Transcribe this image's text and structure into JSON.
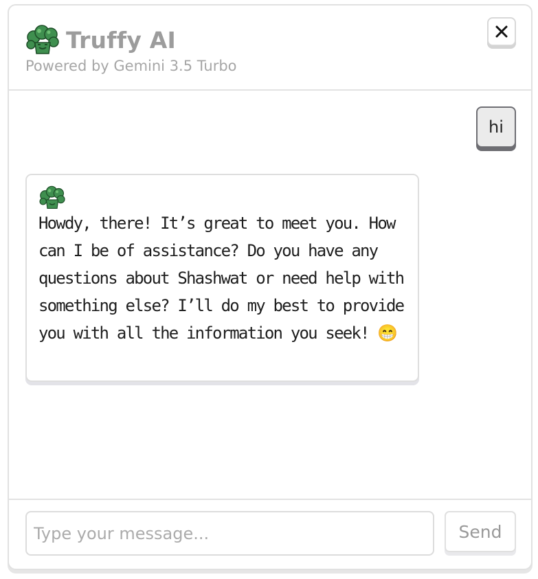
{
  "header": {
    "title": "Truffy AI",
    "subtitle": "Powered by Gemini 3.5 Turbo",
    "logo_icon": "broccoli-icon",
    "close_label": "✕"
  },
  "messages": [
    {
      "role": "user",
      "text": "hi"
    },
    {
      "role": "assistant",
      "icon": "broccoli-icon",
      "text": "Howdy, there! It’s great to meet you. How can I be of assistance? Do you have any questions about Shashwat or need help with something else? I’ll do my best to provide you with all the information you seek! 😁"
    }
  ],
  "composer": {
    "placeholder": "Type your message...",
    "value": "",
    "send_label": "Send"
  },
  "colors": {
    "brand_green": "#3f8f4f",
    "title_gray": "#9c9c9c",
    "user_bubble_bg": "#ebebeb",
    "user_bubble_border": "#6e6e73"
  }
}
